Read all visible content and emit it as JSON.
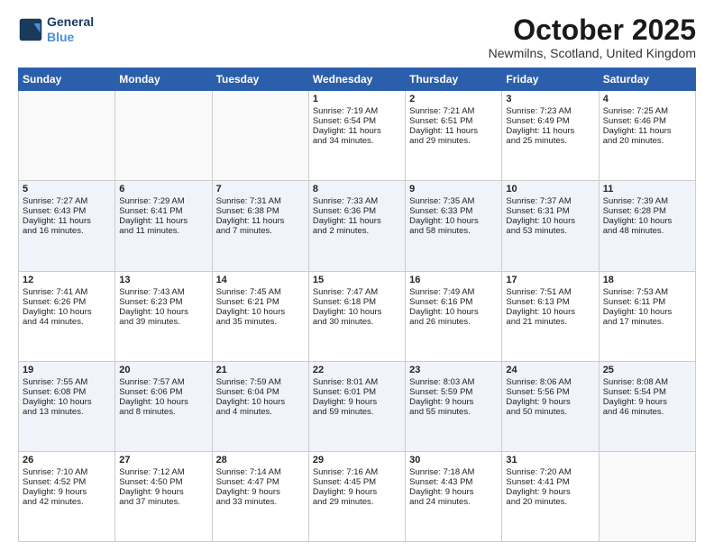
{
  "header": {
    "logo_line1": "General",
    "logo_line2": "Blue",
    "month": "October 2025",
    "location": "Newmilns, Scotland, United Kingdom"
  },
  "weekdays": [
    "Sunday",
    "Monday",
    "Tuesday",
    "Wednesday",
    "Thursday",
    "Friday",
    "Saturday"
  ],
  "weeks": [
    [
      {
        "day": "",
        "info": ""
      },
      {
        "day": "",
        "info": ""
      },
      {
        "day": "",
        "info": ""
      },
      {
        "day": "1",
        "info": "Sunrise: 7:19 AM\nSunset: 6:54 PM\nDaylight: 11 hours\nand 34 minutes."
      },
      {
        "day": "2",
        "info": "Sunrise: 7:21 AM\nSunset: 6:51 PM\nDaylight: 11 hours\nand 29 minutes."
      },
      {
        "day": "3",
        "info": "Sunrise: 7:23 AM\nSunset: 6:49 PM\nDaylight: 11 hours\nand 25 minutes."
      },
      {
        "day": "4",
        "info": "Sunrise: 7:25 AM\nSunset: 6:46 PM\nDaylight: 11 hours\nand 20 minutes."
      }
    ],
    [
      {
        "day": "5",
        "info": "Sunrise: 7:27 AM\nSunset: 6:43 PM\nDaylight: 11 hours\nand 16 minutes."
      },
      {
        "day": "6",
        "info": "Sunrise: 7:29 AM\nSunset: 6:41 PM\nDaylight: 11 hours\nand 11 minutes."
      },
      {
        "day": "7",
        "info": "Sunrise: 7:31 AM\nSunset: 6:38 PM\nDaylight: 11 hours\nand 7 minutes."
      },
      {
        "day": "8",
        "info": "Sunrise: 7:33 AM\nSunset: 6:36 PM\nDaylight: 11 hours\nand 2 minutes."
      },
      {
        "day": "9",
        "info": "Sunrise: 7:35 AM\nSunset: 6:33 PM\nDaylight: 10 hours\nand 58 minutes."
      },
      {
        "day": "10",
        "info": "Sunrise: 7:37 AM\nSunset: 6:31 PM\nDaylight: 10 hours\nand 53 minutes."
      },
      {
        "day": "11",
        "info": "Sunrise: 7:39 AM\nSunset: 6:28 PM\nDaylight: 10 hours\nand 48 minutes."
      }
    ],
    [
      {
        "day": "12",
        "info": "Sunrise: 7:41 AM\nSunset: 6:26 PM\nDaylight: 10 hours\nand 44 minutes."
      },
      {
        "day": "13",
        "info": "Sunrise: 7:43 AM\nSunset: 6:23 PM\nDaylight: 10 hours\nand 39 minutes."
      },
      {
        "day": "14",
        "info": "Sunrise: 7:45 AM\nSunset: 6:21 PM\nDaylight: 10 hours\nand 35 minutes."
      },
      {
        "day": "15",
        "info": "Sunrise: 7:47 AM\nSunset: 6:18 PM\nDaylight: 10 hours\nand 30 minutes."
      },
      {
        "day": "16",
        "info": "Sunrise: 7:49 AM\nSunset: 6:16 PM\nDaylight: 10 hours\nand 26 minutes."
      },
      {
        "day": "17",
        "info": "Sunrise: 7:51 AM\nSunset: 6:13 PM\nDaylight: 10 hours\nand 21 minutes."
      },
      {
        "day": "18",
        "info": "Sunrise: 7:53 AM\nSunset: 6:11 PM\nDaylight: 10 hours\nand 17 minutes."
      }
    ],
    [
      {
        "day": "19",
        "info": "Sunrise: 7:55 AM\nSunset: 6:08 PM\nDaylight: 10 hours\nand 13 minutes."
      },
      {
        "day": "20",
        "info": "Sunrise: 7:57 AM\nSunset: 6:06 PM\nDaylight: 10 hours\nand 8 minutes."
      },
      {
        "day": "21",
        "info": "Sunrise: 7:59 AM\nSunset: 6:04 PM\nDaylight: 10 hours\nand 4 minutes."
      },
      {
        "day": "22",
        "info": "Sunrise: 8:01 AM\nSunset: 6:01 PM\nDaylight: 9 hours\nand 59 minutes."
      },
      {
        "day": "23",
        "info": "Sunrise: 8:03 AM\nSunset: 5:59 PM\nDaylight: 9 hours\nand 55 minutes."
      },
      {
        "day": "24",
        "info": "Sunrise: 8:06 AM\nSunset: 5:56 PM\nDaylight: 9 hours\nand 50 minutes."
      },
      {
        "day": "25",
        "info": "Sunrise: 8:08 AM\nSunset: 5:54 PM\nDaylight: 9 hours\nand 46 minutes."
      }
    ],
    [
      {
        "day": "26",
        "info": "Sunrise: 7:10 AM\nSunset: 4:52 PM\nDaylight: 9 hours\nand 42 minutes."
      },
      {
        "day": "27",
        "info": "Sunrise: 7:12 AM\nSunset: 4:50 PM\nDaylight: 9 hours\nand 37 minutes."
      },
      {
        "day": "28",
        "info": "Sunrise: 7:14 AM\nSunset: 4:47 PM\nDaylight: 9 hours\nand 33 minutes."
      },
      {
        "day": "29",
        "info": "Sunrise: 7:16 AM\nSunset: 4:45 PM\nDaylight: 9 hours\nand 29 minutes."
      },
      {
        "day": "30",
        "info": "Sunrise: 7:18 AM\nSunset: 4:43 PM\nDaylight: 9 hours\nand 24 minutes."
      },
      {
        "day": "31",
        "info": "Sunrise: 7:20 AM\nSunset: 4:41 PM\nDaylight: 9 hours\nand 20 minutes."
      },
      {
        "day": "",
        "info": ""
      }
    ]
  ]
}
